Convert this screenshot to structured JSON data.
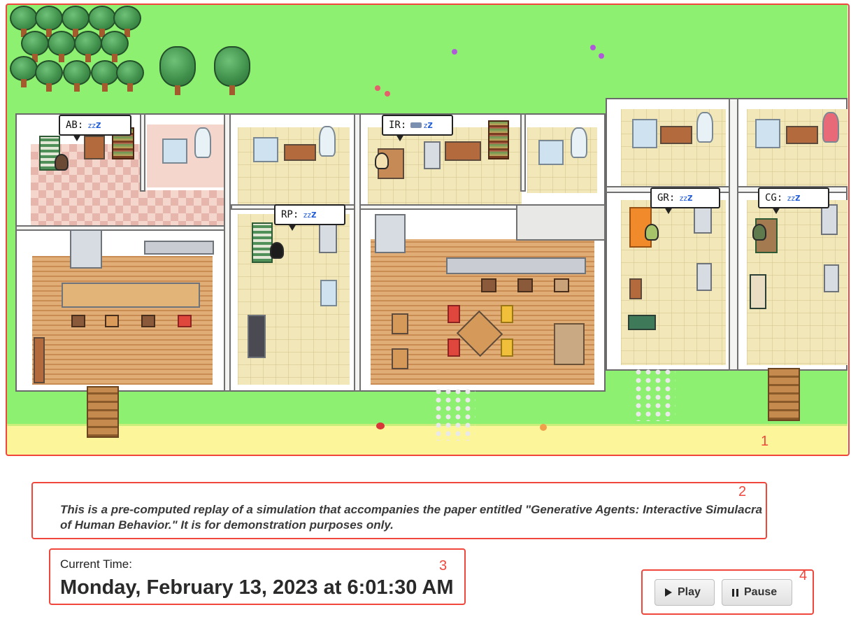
{
  "agents": [
    {
      "id": "AB",
      "status": "sleeping",
      "bubble_text": "AB:"
    },
    {
      "id": "IR",
      "status": "sleeping-in-bed",
      "bubble_text": "IR:"
    },
    {
      "id": "RP",
      "status": "sleeping",
      "bubble_text": "RP:"
    },
    {
      "id": "GR",
      "status": "sleeping",
      "bubble_text": "GR:"
    },
    {
      "id": "CG",
      "status": "sleeping",
      "bubble_text": "CG:"
    }
  ],
  "sleep_icon": "zzz-icon",
  "bed_icon": "bed-icon",
  "annotations": [
    "1",
    "2",
    "3",
    "4"
  ],
  "caption": "This is a pre-computed replay of a simulation that accompanies the paper entitled \"Generative Agents: Interactive Simulacra of Human Behavior.\" It is for demonstration purposes only.",
  "time": {
    "label": "Current Time:",
    "value": "Monday, February 13, 2023 at 6:01:30 AM"
  },
  "controls": {
    "play_label": "Play",
    "pause_label": "Pause",
    "play_icon": "play-icon",
    "pause_icon": "pause-icon"
  },
  "colors": {
    "grass": "#8ef070",
    "sand": "#fdf59a",
    "annotation": "#f0463c",
    "sleep_z": "#1f5bd6"
  }
}
